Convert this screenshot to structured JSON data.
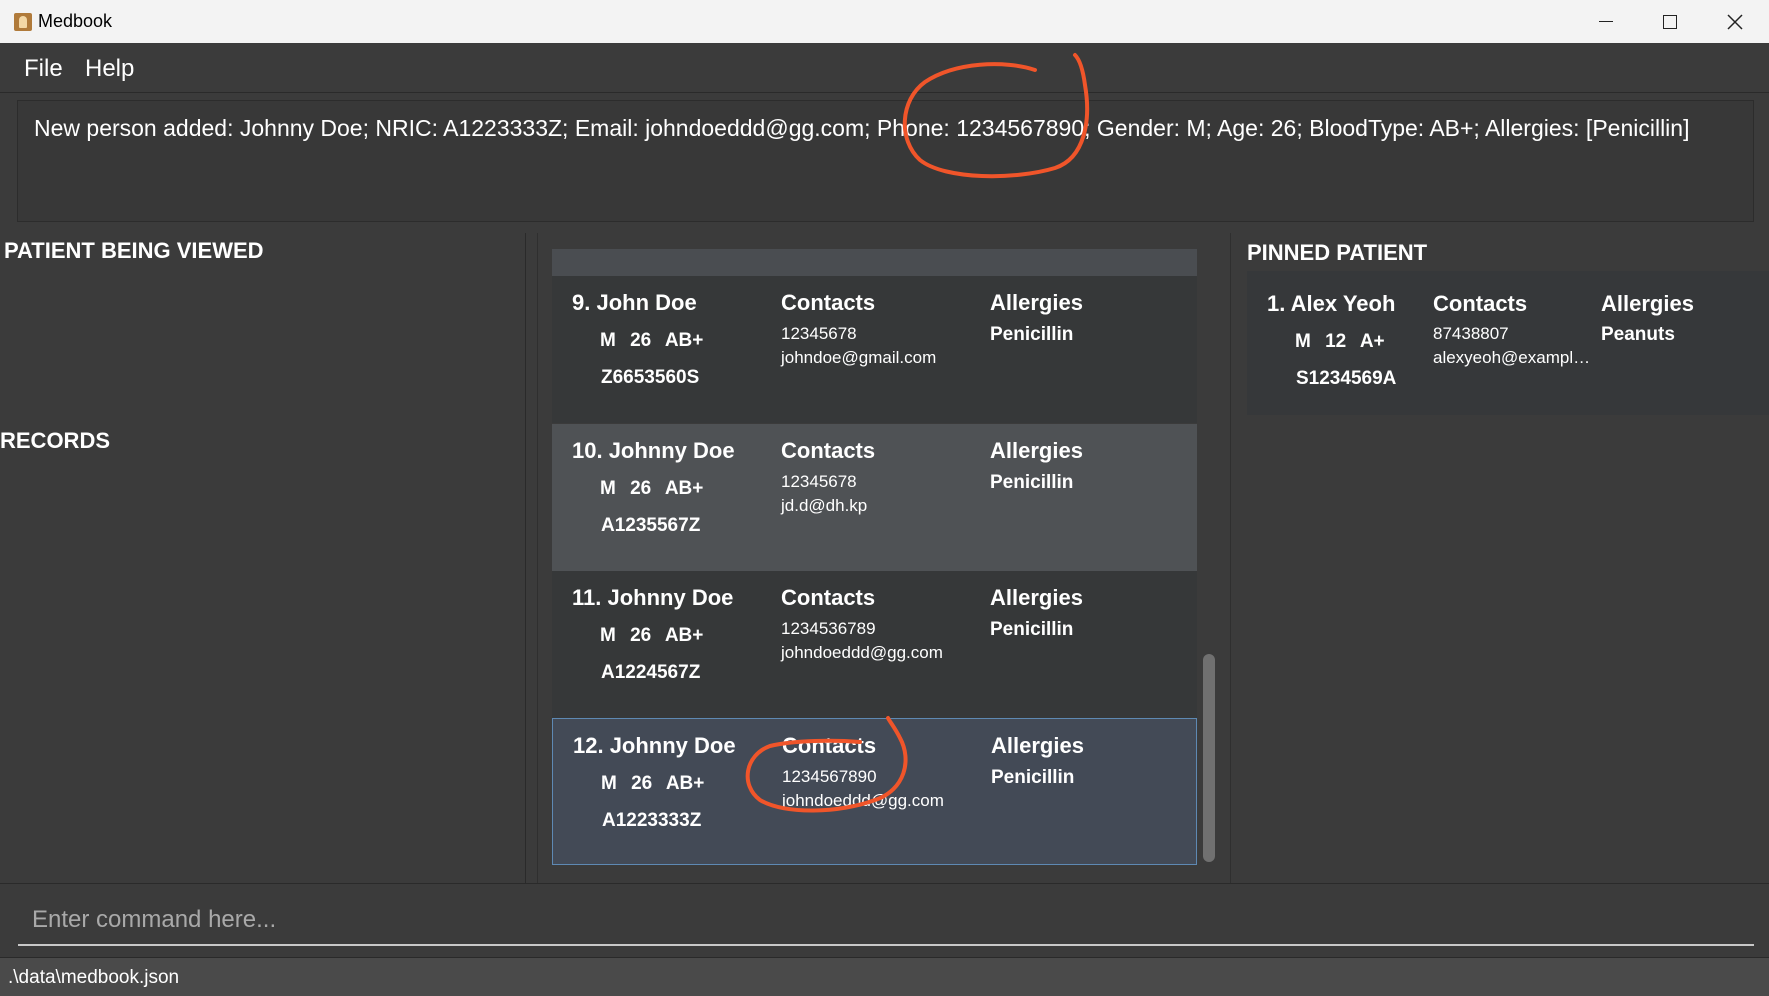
{
  "window": {
    "title": "Medbook"
  },
  "menu": {
    "file": "File",
    "help": "Help"
  },
  "result": {
    "message": "New person added: Johnny Doe; NRIC: A1223333Z; Email: johndoeddd@gg.com; Phone: 1234567890; Gender: M; Age: 26; BloodType: AB+; Allergies: [Penicillin]"
  },
  "sections": {
    "viewed": "PATIENT BEING VIEWED",
    "records": "RECORDS",
    "pinned": "PINNED PATIENT"
  },
  "patients": [
    {
      "name": "9. John Doe",
      "tags": "M 26 AB+",
      "nric": "Z6653560S",
      "contacts_label": "Contacts",
      "phone": "12345678",
      "email": "johndoe@gmail.com",
      "allergies_label": "Allergies",
      "allergy": "Penicillin"
    },
    {
      "name": "10. Johnny Doe",
      "tags": "M 26 AB+",
      "nric": "A1235567Z",
      "contacts_label": "Contacts",
      "phone": "12345678",
      "email": "jd.d@dh.kp",
      "allergies_label": "Allergies",
      "allergy": "Penicillin"
    },
    {
      "name": "11. Johnny Doe",
      "tags": "M 26 AB+",
      "nric": "A1224567Z",
      "contacts_label": "Contacts",
      "phone": "1234536789",
      "email": "johndoeddd@gg.com",
      "allergies_label": "Allergies",
      "allergy": "Penicillin"
    },
    {
      "name": "12. Johnny Doe",
      "tags": "M 26 AB+",
      "nric": "A1223333Z",
      "contacts_label": "Contacts",
      "phone": "1234567890",
      "email": "johndoeddd@gg.com",
      "allergies_label": "Allergies",
      "allergy": "Penicillin"
    }
  ],
  "pinned": {
    "name": "1. Alex Yeoh",
    "tags": "M 12 A+",
    "nric": "S1234569A",
    "contacts_label": "Contacts",
    "phone": "87438807",
    "email": "alexyeoh@example.com",
    "allergies_label": "Allergies",
    "allergy": "Peanuts"
  },
  "command": {
    "placeholder": "Enter command here..."
  },
  "status": {
    "path": ".\\data\\medbook.json"
  },
  "colors": {
    "annotation": "#f0552a",
    "selection_border": "#5e89b3"
  }
}
